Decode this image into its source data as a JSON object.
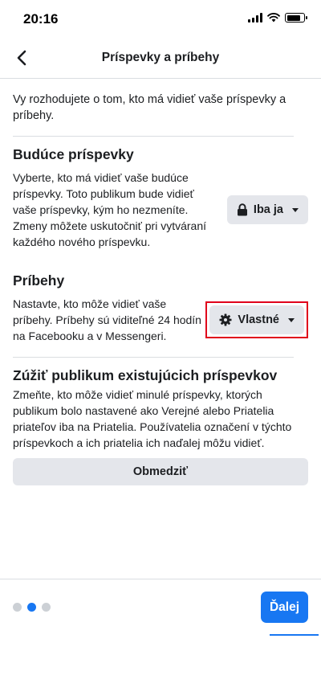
{
  "status_bar": {
    "time": "20:16",
    "battery_level": 0.8
  },
  "header": {
    "title": "Príspevky a príbehy",
    "back_icon": "chevron-left-icon"
  },
  "intro_text": "Vy rozhodujete o tom, kto má vidieť vaše príspevky a príbehy.",
  "future_posts": {
    "title": "Budúce príspevky",
    "description": "Vyberte, kto má vidieť vaše budúce príspevky. Toto publikum bude vidieť vaše príspevky, kým ho nezmeníte. Zmeny môžete uskutočniť pri vytváraní každého nového príspevku.",
    "selector_label": "Iba ja",
    "selector_icon": "lock-icon"
  },
  "stories": {
    "title": "Príbehy",
    "description": "Nastavte, kto môže vidieť vaše príbehy. Príbehy sú viditeľné 24 hodín na Facebooku a v Messengeri.",
    "selector_label": "Vlastné",
    "selector_icon": "gear-icon"
  },
  "limit_past": {
    "title": "Zúžiť publikum existujúcich príspevkov",
    "description": "Zmeňte, kto môže vidieť minulé príspevky, ktorých publikum bolo nastavené ako Verejné alebo Priatelia priateľov iba na Priatelia. Používatelia označení v týchto príspevkoch a ich priatelia ich naďalej môžu vidieť.",
    "button_label": "Obmedziť"
  },
  "footer": {
    "page_count": 3,
    "active_page": 2,
    "next_label": "Ďalej"
  },
  "colors": {
    "accent": "#1877f2",
    "highlight": "#e0001b",
    "pill_bg": "#e4e6eb"
  }
}
